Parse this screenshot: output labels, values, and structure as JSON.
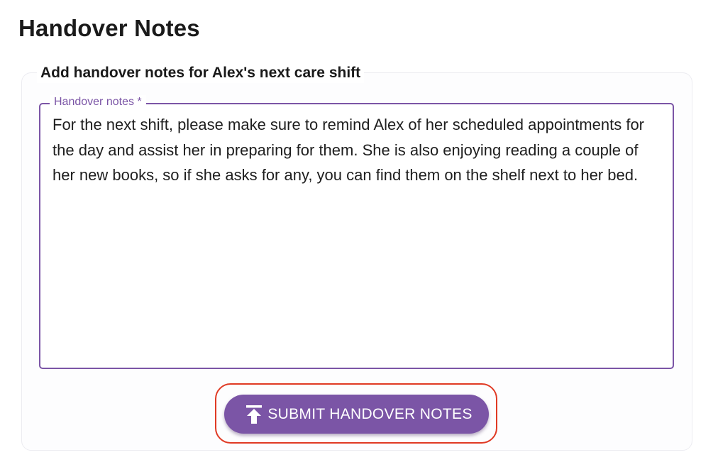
{
  "page": {
    "title": "Handover Notes"
  },
  "form": {
    "section_title": "Add handover notes for Alex's next care shift",
    "notes_field": {
      "label": "Handover notes *",
      "value": "For the next shift, please make sure to remind Alex of her scheduled appointments for the day and assist her in preparing for them. She is also enjoying reading a couple of her new books, so if she asks for any, you can find them on the shelf next to her bed."
    },
    "submit": {
      "label": "SUBMIT HANDOVER NOTES",
      "icon": "upload-icon"
    }
  },
  "colors": {
    "accent": "#7b55a6",
    "highlight_outline": "#e03a24"
  }
}
